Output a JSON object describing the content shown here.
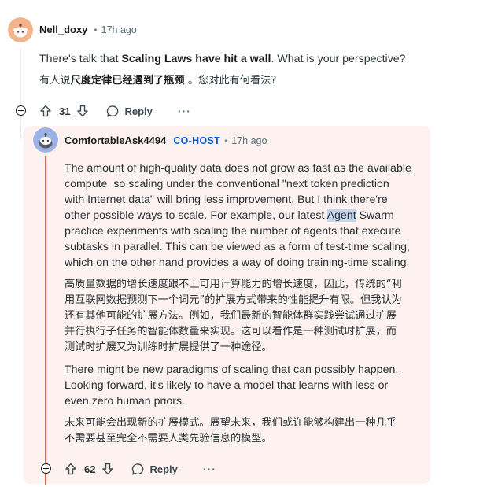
{
  "comment": {
    "username": "Nell_doxy",
    "separator": "•",
    "time": "17h ago",
    "text_en_pre": "There's talk that ",
    "text_en_bold": "Scaling Laws have hit a wall",
    "text_en_post": ". What is your perspective?",
    "text_zh_pre": "有人说",
    "text_zh_bold": "尺度定律已经遇到了瓶颈",
    "text_zh_post": " 。您对此有何看法?",
    "votes": "31",
    "reply_label": "Reply",
    "more_label": "···"
  },
  "reply": {
    "username": "ComfortableAsk4494",
    "badge": "CO-HOST",
    "separator": "•",
    "time": "17h ago",
    "p1_lines": [
      "The amount of high-quality data does not grow as fast as the available",
      "compute, so scaling under the conventional \"next token prediction",
      "with Internet data\" will bring less improvement. But I think there're",
      "other possible ways to scale. For example, our latest ",
      "practice experiments with scaling the number of agents that execute",
      "subtasks in parallel. This can be viewed as a form of test-time scaling,",
      "which on the other hand provides a way of doing training-time scaling."
    ],
    "p1_highlight": "Agent",
    "p1_after_highlight": " Swarm",
    "p2_lines": [
      "高质量数据的增长速度跟不上可用计算能力的增长速度，因此，传统的“利",
      "用互联网数据预测下一个词元”的扩展方式带来的性能提升有限。但我认为",
      "还有其他可能的扩展方法。例如，我们最新的智能体群实践尝试通过扩展",
      "并行执行子任务的智能体数量来实现。这可以看作是一种测试时扩展，而",
      "测试时扩展又为训练时扩展提供了一种途径。"
    ],
    "p3_lines": [
      "There might be new paradigms of scaling that can possibly happen.",
      "Looking forward, it's likely to have a model that learns with less or",
      "even zero human priors."
    ],
    "p4_lines": [
      "未来可能会出现新的扩展模式。展望未来，我们或许能够构建出一种几乎",
      "不需要甚至完全不需要人类先验信息的模型。"
    ],
    "votes": "62",
    "reply_label": "Reply",
    "more_label": "···"
  },
  "colors": {
    "cohost_badge": "#0a5fd8",
    "reply_background": "#fdf2f0",
    "thread_highlight": "#e8613c",
    "text_highlight": "#c7d5ec"
  },
  "icons": {
    "avatar_1": "snoo-avatar-orange",
    "avatar_2": "snoo-avatar-blue",
    "upvote": "arrow-up-icon",
    "downvote": "arrow-down-icon",
    "reply": "speech-bubble-icon",
    "collapse": "minus-circle-icon"
  }
}
